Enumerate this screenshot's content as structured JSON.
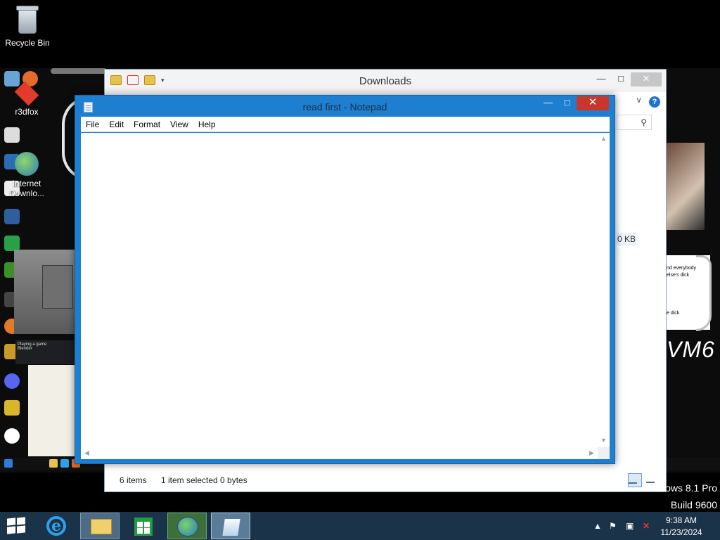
{
  "desktop": {
    "recycle_bin_label": "Recycle Bin",
    "background_icons": [
      {
        "label": "r3dfox"
      },
      {
        "label": "Internet Downlo..."
      }
    ],
    "watermark": {
      "line1": "ows 8.1 Pro",
      "line2": "Build 9600"
    },
    "wallpaper_fragment": {
      "note_lines": [
        "nd everybody",
        "else's dick",
        "e dick"
      ],
      "big_text": "VM6",
      "discord_line1": "Playing a game",
      "discord_line2": "Blender"
    }
  },
  "explorer": {
    "title": "Downloads",
    "status_items": "6 items",
    "status_selected": "1 item selected  0 bytes",
    "size_cell": "0 KB"
  },
  "notepad": {
    "title": "read first - Notepad",
    "menu": [
      "File",
      "Edit",
      "Format",
      "View",
      "Help"
    ],
    "content": ""
  },
  "taskbar": {
    "time": "9:38 AM",
    "date": "11/23/2024",
    "apps": [
      {
        "name": "internet-explorer"
      },
      {
        "name": "file-explorer"
      },
      {
        "name": "windows-store"
      },
      {
        "name": "internet-download-manager"
      },
      {
        "name": "notepad"
      }
    ]
  },
  "colors": {
    "notepad_frame": "#1e7fd0",
    "close_button": "#c7372c",
    "taskbar": "#1b3348"
  }
}
